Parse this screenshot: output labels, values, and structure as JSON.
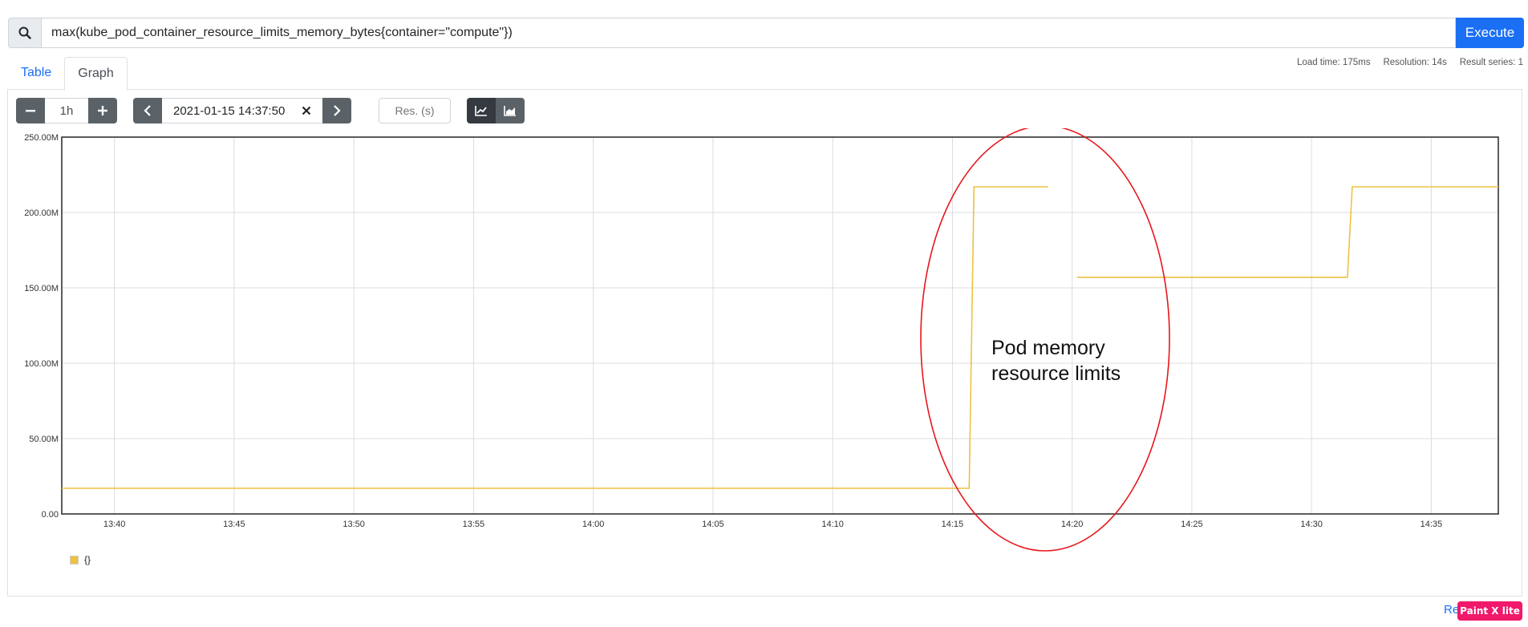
{
  "query": {
    "expression": "max(kube_pod_container_resource_limits_memory_bytes{container=\"compute\"})",
    "execute_label": "Execute"
  },
  "tabs": [
    {
      "label": "Table",
      "active": false
    },
    {
      "label": "Graph",
      "active": true
    }
  ],
  "stats": {
    "load_time": "Load time: 175ms",
    "resolution": "Resolution: 14s",
    "result_series": "Result series: 1"
  },
  "controls": {
    "range": "1h",
    "end_time": "2021-01-15 14:37:50",
    "resolution_placeholder": "Res. (s)"
  },
  "annotation": {
    "line1": "Pod memory",
    "line2": "resource limits",
    "color": "#e8161b"
  },
  "legend": {
    "label": "{}"
  },
  "footer": {
    "link_text": "Re",
    "badge_text": "Paint X lite"
  },
  "icons": [
    "search-icon",
    "minus-icon",
    "plus-icon",
    "chevron-left-icon",
    "close-icon",
    "chevron-right-icon",
    "line-chart-icon",
    "stacked-chart-icon"
  ],
  "chart_data": {
    "type": "line",
    "series_color": "#edc240",
    "x_tick_labels": [
      "13:40",
      "13:45",
      "13:50",
      "13:55",
      "14:00",
      "14:05",
      "14:10",
      "14:15",
      "14:20",
      "14:25",
      "14:30",
      "14:35"
    ],
    "x_tick_minutes": [
      40,
      45,
      50,
      55,
      60,
      65,
      70,
      75,
      80,
      85,
      90,
      95
    ],
    "xlim_minutes": [
      37.8,
      97.8
    ],
    "y_tick_labels": [
      "0.00",
      "50.00M",
      "100.00M",
      "150.00M",
      "200.00M",
      "250.00M"
    ],
    "y_tick_values": [
      0,
      50,
      100,
      150,
      200,
      250
    ],
    "ylim": [
      0,
      250
    ],
    "y_unit": "M",
    "grid": true,
    "legend_position": "bottom-left",
    "segments": [
      [
        [
          37.8,
          17
        ],
        [
          75.7,
          17
        ],
        [
          75.9,
          217
        ],
        [
          79.0,
          217
        ]
      ],
      [
        [
          80.2,
          157
        ],
        [
          91.5,
          157
        ],
        [
          91.7,
          217
        ],
        [
          97.8,
          217
        ]
      ]
    ]
  }
}
